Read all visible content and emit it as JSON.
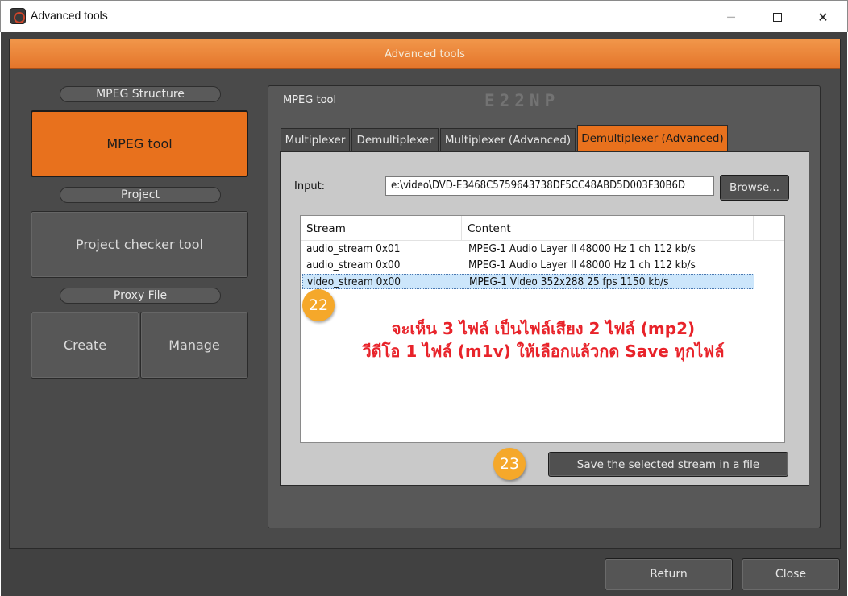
{
  "window": {
    "title": "Advanced tools",
    "minimize_icon": "minimize-icon",
    "maximize_icon": "maximize-icon",
    "close_icon": "close-icon"
  },
  "header": {
    "title": "Advanced tools"
  },
  "sidebar": {
    "sections": [
      {
        "label": "MPEG Structure",
        "buttons": [
          "MPEG tool"
        ]
      },
      {
        "label": "Project",
        "buttons": [
          "Project checker tool"
        ]
      },
      {
        "label": "Proxy File",
        "buttons": [
          "Create",
          "Manage"
        ]
      }
    ],
    "active_button": "MPEG tool"
  },
  "panel": {
    "title": "MPEG tool",
    "brand": "E22NP",
    "tabs": [
      {
        "label": "Multiplexer",
        "active": false
      },
      {
        "label": "Demultiplexer",
        "active": false
      },
      {
        "label": "Multiplexer (Advanced)",
        "active": false
      },
      {
        "label": "Demultiplexer (Advanced)",
        "active": true
      }
    ],
    "input": {
      "label": "Input:",
      "value": "e:\\video\\DVD-E3468C5759643738DF5CC48ABD5D003F30B6D",
      "browse_label": "Browse..."
    },
    "streams": {
      "columns": [
        "Stream",
        "Content"
      ],
      "rows": [
        {
          "stream": "audio_stream 0x01",
          "content": "MPEG-1 Audio Layer II 48000 Hz 1 ch 112 kb/s",
          "selected": false
        },
        {
          "stream": "audio_stream 0x00",
          "content": "MPEG-1 Audio Layer II 48000 Hz 1 ch 112 kb/s",
          "selected": false
        },
        {
          "stream": "video_stream 0x00",
          "content": "MPEG-1 Video 352x288 25 fps 1150 kb/s",
          "selected": true
        }
      ]
    },
    "annotation": {
      "line1": "จะเห็น 3 ไฟล์ เป็นไฟล์เสียง 2 ไฟล์ (mp2)",
      "line2": "วีดีโอ 1 ไฟล์ (m1v) ให้เลือกแล้วกด Save ทุกไฟล์",
      "color": "#e8232a"
    },
    "save_label": "Save the selected stream in a file",
    "badges": [
      "22",
      "23"
    ]
  },
  "footer": {
    "return_label": "Return",
    "close_label": "Close"
  },
  "colors": {
    "accent": "#e8711d",
    "badge": "#f5a82a",
    "background": "#414141"
  }
}
